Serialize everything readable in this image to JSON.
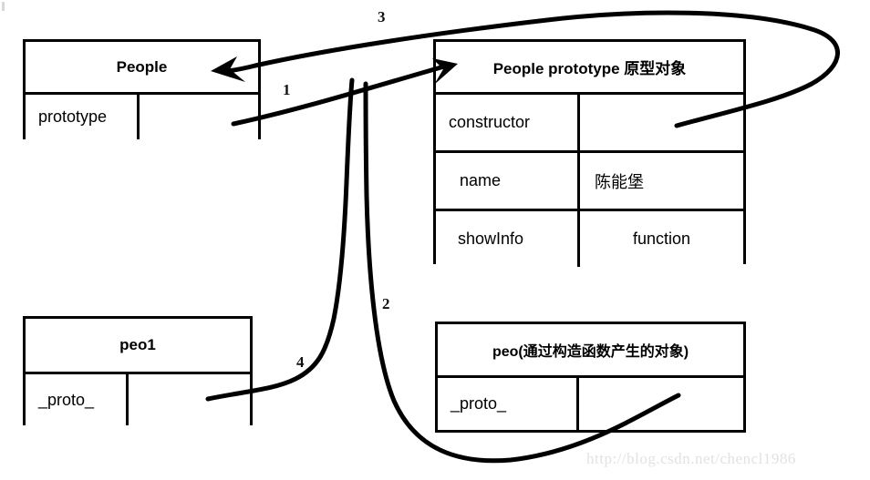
{
  "diagram": {
    "title_note": "JavaScript prototype chain diagram",
    "watermark": "http://blog.csdn.net/chencl1986",
    "stroke_color": "#000000",
    "background_color": "#ffffff",
    "watermark_color": "#e2e2e2"
  },
  "boxes": {
    "people": {
      "header": "People",
      "rows": [
        {
          "key": "prototype",
          "value": ""
        }
      ]
    },
    "people_prototype": {
      "header": "People prototype  原型对象",
      "rows": [
        {
          "key": "constructor",
          "value": ""
        },
        {
          "key": "name",
          "value": "陈能堡"
        },
        {
          "key": "showInfo",
          "value": "function"
        }
      ]
    },
    "peo1": {
      "header": "peo1",
      "rows": [
        {
          "key": "_proto_",
          "value": ""
        }
      ]
    },
    "peo": {
      "header": "peo(通过构造函数产生的对象)",
      "rows": [
        {
          "key": "_proto_",
          "value": ""
        }
      ]
    }
  },
  "arrows": [
    {
      "id": "1",
      "label": "1",
      "from": "people.prototype-value",
      "to": "people_prototype.header",
      "arrowhead": true
    },
    {
      "id": "2",
      "label": "2",
      "from": "peo._proto_-value",
      "to": "people_prototype.header",
      "arrowhead": false
    },
    {
      "id": "3",
      "label": "3",
      "from": "people_prototype.constructor-value",
      "to": "people.header",
      "arrowhead": true
    },
    {
      "id": "4",
      "label": "4",
      "from": "peo1._proto_-value",
      "to": "people_prototype",
      "arrowhead": false
    }
  ]
}
